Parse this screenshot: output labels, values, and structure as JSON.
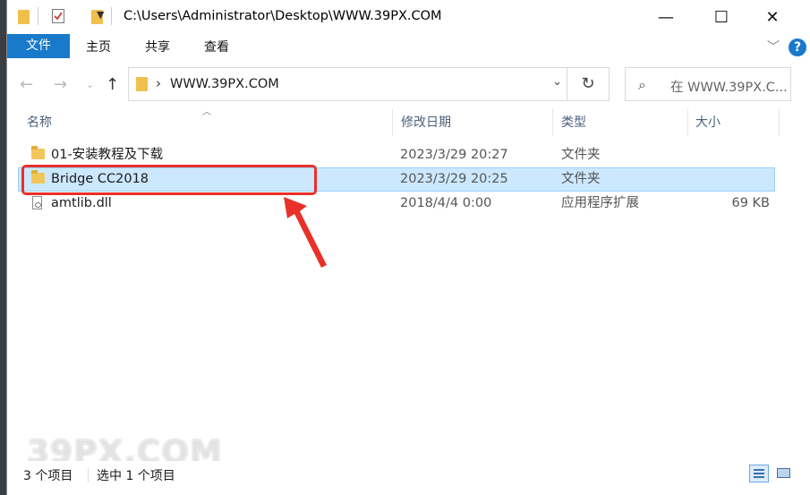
{
  "window": {
    "title_path": "C:\\Users\\Administrator\\Desktop\\WWW.39PX.COM",
    "minimize": "—",
    "maximize": "☐",
    "close": "✕"
  },
  "ribbon": {
    "tabs": [
      "文件",
      "主页",
      "共享",
      "查看"
    ],
    "help": "?"
  },
  "navigation": {
    "address": "WWW.39PX.COM",
    "search_placeholder": "在 WWW.39PX.C..."
  },
  "columns": {
    "name": "名称",
    "date": "修改日期",
    "type": "类型",
    "size": "大小"
  },
  "files": [
    {
      "name": "01-安装教程及下载",
      "date": "2023/3/29 20:27",
      "type": "文件夹",
      "size": "",
      "kind": "folder",
      "selected": false
    },
    {
      "name": "Bridge CC2018",
      "date": "2023/3/29 20:25",
      "type": "文件夹",
      "size": "",
      "kind": "folder",
      "selected": true
    },
    {
      "name": "amtlib.dll",
      "date": "2018/4/4 0:00",
      "type": "应用程序扩展",
      "size": "69 KB",
      "kind": "file",
      "selected": false
    }
  ],
  "status": {
    "item_count": "3 个项目",
    "selected_count": "选中 1 个项目"
  },
  "watermark": "39PX.COM",
  "colors": {
    "accent": "#1979ca",
    "selection": "#cce8ff",
    "annotation": "#e8312a"
  }
}
